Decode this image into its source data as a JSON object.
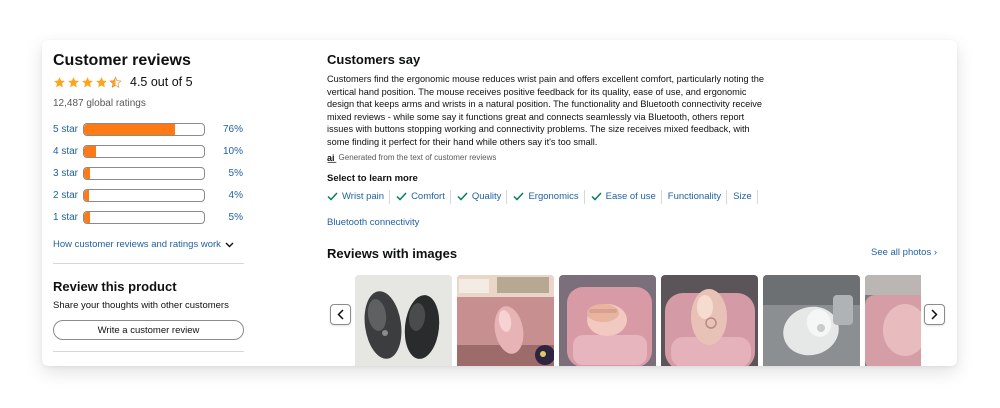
{
  "reviews": {
    "title": "Customer reviews",
    "rating_text": "4.5 out of 5",
    "rating_value": 4.5,
    "global_ratings": "12,487 global ratings",
    "histogram": [
      {
        "label": "5 star",
        "pct": "76%",
        "value": 76
      },
      {
        "label": "4 star",
        "pct": "10%",
        "value": 10
      },
      {
        "label": "3 star",
        "pct": "5%",
        "value": 5
      },
      {
        "label": "2 star",
        "pct": "4%",
        "value": 4
      },
      {
        "label": "1 star",
        "pct": "5%",
        "value": 5
      }
    ],
    "how_link": "How customer reviews and ratings work"
  },
  "review_product": {
    "title": "Review this product",
    "subtitle": "Share your thoughts with other customers",
    "button": "Write a customer review"
  },
  "customers_say": {
    "title": "Customers say",
    "body": "Customers find the ergonomic mouse reduces wrist pain and offers excellent comfort, particularly noting the vertical hand position. The mouse receives positive feedback for its quality, ease of use, and ergonomic design that keeps arms and wrists in a natural position. The functionality and Bluetooth connectivity receive mixed reviews - while some say it functions great and connects seamlessly via Bluetooth, others report issues with buttons stopping working and connectivity problems. The size receives mixed feedback, with some finding it perfect for their hand while others say it's too small.",
    "ai_note": "Generated from the text of customer reviews",
    "select_title": "Select to learn more",
    "chips": [
      {
        "label": "Wrist pain",
        "checked": true
      },
      {
        "label": "Comfort",
        "checked": true
      },
      {
        "label": "Quality",
        "checked": true
      },
      {
        "label": "Ergonomics",
        "checked": true
      },
      {
        "label": "Ease of use",
        "checked": true
      },
      {
        "label": "Functionality",
        "checked": false
      },
      {
        "label": "Size",
        "checked": false
      },
      {
        "label": "Bluetooth connectivity",
        "checked": false
      }
    ]
  },
  "images_section": {
    "title": "Reviews with images",
    "see_all": "See all photos ›"
  },
  "colors": {
    "star": "#ffa41c",
    "bar_fill": "#ff7a14",
    "link": "#2162a1",
    "check": "#067d62"
  }
}
